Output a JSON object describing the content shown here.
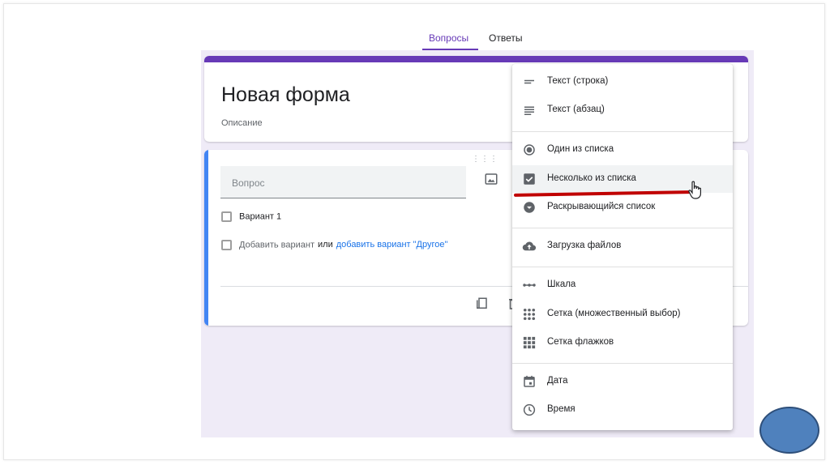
{
  "tabs": {
    "questions": "Вопросы",
    "answers": "Ответы"
  },
  "form": {
    "title": "Новая форма",
    "description": "Описание"
  },
  "question": {
    "placeholder": "Вопрос",
    "option1": "Вариант 1",
    "add_option": "Добавить вариант",
    "or": "или",
    "add_other": "добавить вариант \"Другое\""
  },
  "menu": {
    "items": [
      {
        "label": "Текст (строка)",
        "icon": "short-text-icon"
      },
      {
        "label": "Текст (абзац)",
        "icon": "paragraph-icon"
      },
      {
        "label": "Один из списка",
        "icon": "radio-button-icon"
      },
      {
        "label": "Несколько из списка",
        "icon": "checkbox-icon"
      },
      {
        "label": "Раскрывающийся список",
        "icon": "dropdown-icon"
      },
      {
        "label": "Загрузка файлов",
        "icon": "cloud-upload-icon"
      },
      {
        "label": "Шкала",
        "icon": "linear-scale-icon"
      },
      {
        "label": "Сетка (множественный выбор)",
        "icon": "grid-dots-icon"
      },
      {
        "label": "Сетка флажков",
        "icon": "grid-squares-icon"
      },
      {
        "label": "Дата",
        "icon": "calendar-icon"
      },
      {
        "label": "Время",
        "icon": "clock-icon"
      }
    ]
  },
  "colors": {
    "accent": "#673ab7",
    "question_bar": "#4285f4",
    "annotation_red": "#c00000",
    "circle": "#4f81bd"
  }
}
